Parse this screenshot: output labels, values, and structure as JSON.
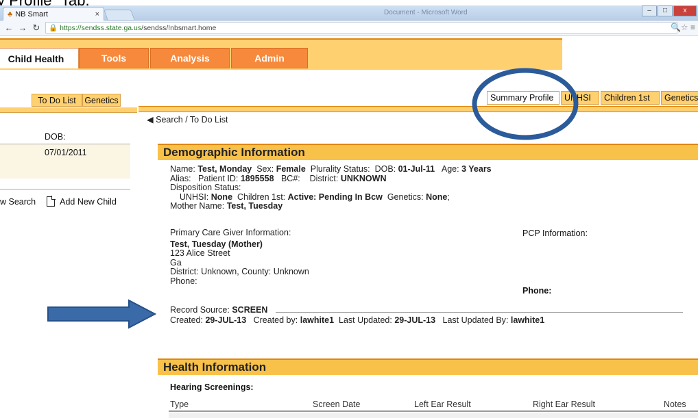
{
  "slide_caption": "y Profile\" Tab.",
  "browser": {
    "tab_title": "NB Smart",
    "tab_close": "×",
    "background_window_title": "Document - Microsoft Word",
    "url_host": "https://sendss.state.ga.us",
    "url_path": "/sendss/!nbsmart.home",
    "controls": {
      "minimize": "–",
      "maximize": "□",
      "close": "x"
    }
  },
  "app_tabs": [
    {
      "label": "Child Health",
      "active": true
    },
    {
      "label": "Tools",
      "active": false
    },
    {
      "label": "Analysis",
      "active": false
    },
    {
      "label": "Admin",
      "active": false
    }
  ],
  "left_subtabs": [
    "To Do List",
    "Genetics"
  ],
  "right_subtabs": [
    {
      "label": "Summary Profile",
      "active": true
    },
    {
      "label": "UNHSI",
      "active": false
    },
    {
      "label": "Children 1st",
      "active": false
    },
    {
      "label": "Genetics",
      "active": false
    }
  ],
  "breadcrumb": "Search / To Do List",
  "patient_panel": {
    "dob_label": "DOB:",
    "dob_value": "07/01/2011",
    "search_link": "w Search",
    "add_child_link": "Add New Child"
  },
  "demographic": {
    "header": "Demographic Information",
    "name_label": "Name:",
    "name": "Test, Monday",
    "sex_label": "Sex:",
    "sex": "Female",
    "plurality_label": "Plurality Status:",
    "dob_label": "DOB:",
    "dob": "01-Jul-11",
    "age_label": "Age:",
    "age": "3 Years",
    "alias_label": "Alias:",
    "patient_id_label": "Patient ID:",
    "patient_id": "1895558",
    "bc_label": "BC#:",
    "district_label": "District:",
    "district": "UNKNOWN",
    "disposition_label": "Disposition Status:",
    "unhsi_label": "UNHSI:",
    "unhsi": "None",
    "children1st_label": "Children 1st:",
    "children1st": "Active: Pending In Bcw",
    "genetics_label": "Genetics:",
    "genetics": "None",
    "mother_label": "Mother Name:",
    "mother": "Test, Tuesday",
    "pcg_label": "Primary Care Giver Information:",
    "pcg_name": "Test, Tuesday (Mother)",
    "pcg_street": "123 Alice Street",
    "pcg_state": "Ga",
    "pcg_district": "District: Unknown, County: Unknown",
    "pcg_phone_label": "Phone:",
    "pcp_label": "PCP Information:",
    "pcp_phone_label": "Phone:",
    "record_source_label": "Record Source:",
    "record_source": "SCREEN",
    "created_label": "Created:",
    "created": "29-JUL-13",
    "created_by_label": "Created by:",
    "created_by": "lawhite1",
    "updated_label": "Last Updated:",
    "updated": "29-JUL-13",
    "updated_by_label": "Last Updated By:",
    "updated_by": "lawhite1"
  },
  "health": {
    "header": "Health Information",
    "hearing_title": "Hearing Screenings:",
    "columns": [
      "Type",
      "Screen Date",
      "Left Ear Result",
      "Right Ear Result",
      "Notes"
    ]
  },
  "annotation_colors": {
    "arrow": "#3a6ba8",
    "ellipse": "#2b5b9a"
  }
}
